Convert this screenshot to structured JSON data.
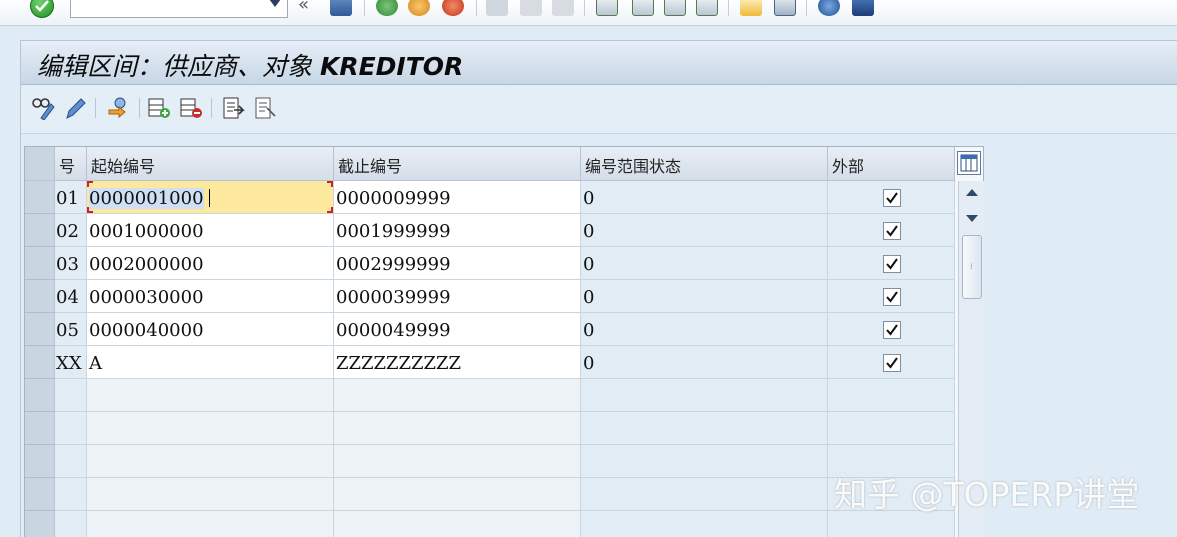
{
  "window": {
    "title_cn": "编辑区间：供应商、对象",
    "title_object": "KREDITOR"
  },
  "system_toolbar": {
    "command_field_value": "",
    "chevron": "«"
  },
  "table": {
    "headers": {
      "no": "号",
      "from": "起始编号",
      "to": "截止编号",
      "status": "编号范围状态",
      "external": "外部"
    },
    "rows": [
      {
        "no": "01",
        "from": "0000001000",
        "to": "0000009999",
        "status": "0",
        "external": true
      },
      {
        "no": "02",
        "from": "0001000000",
        "to": "0001999999",
        "status": "0",
        "external": true
      },
      {
        "no": "03",
        "from": "0002000000",
        "to": "0002999999",
        "status": "0",
        "external": true
      },
      {
        "no": "04",
        "from": "0000030000",
        "to": "0000039999",
        "status": "0",
        "external": true
      },
      {
        "no": "05",
        "from": "0000040000",
        "to": "0000049999",
        "status": "0",
        "external": true
      },
      {
        "no": "XX",
        "from": "A",
        "to": "ZZZZZZZZZZ",
        "status": "0",
        "external": true
      }
    ]
  },
  "watermark": "知乎 @TOPERP讲堂",
  "colors": {
    "frame_bg": "#dfebf5",
    "focus_cell": "#fde99d",
    "ok_green": "#1f8f1f"
  }
}
